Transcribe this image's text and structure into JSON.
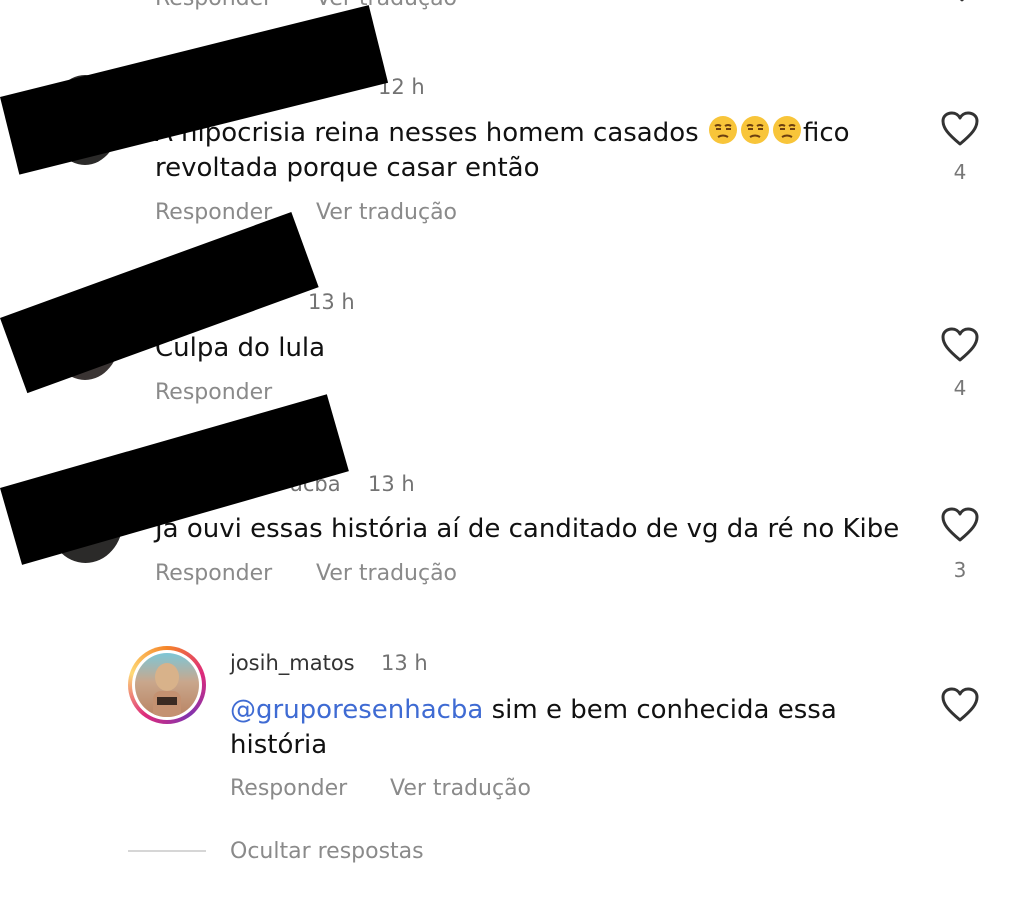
{
  "top_cut": {
    "reply": "Responder",
    "translate": "Ver tradução"
  },
  "comments": [
    {
      "username": "",
      "time": "12 h",
      "text_line1": "A hipocrisia reina nesses homem casados",
      "emoji": "unamused-face",
      "text_after_emoji": "fico",
      "text_line2": "revoltada porque casar então",
      "likes": "4",
      "reply": "Responder",
      "translate": "Ver tradução"
    },
    {
      "username": "",
      "time": "13 h",
      "text": "Culpa do lula",
      "likes": "4",
      "reply": "Responder"
    },
    {
      "username": "acba",
      "time": "13 h",
      "text": "Já ouvi essas história aí de canditado de vg da ré no Kibe",
      "likes": "3",
      "reply": "Responder",
      "translate": "Ver tradução"
    }
  ],
  "reply_comment": {
    "username": "josih_matos",
    "time": "13 h",
    "mention": "@gruporesenhacba",
    "text_rest": " sim e bem conhecida essa",
    "text_line2": "história",
    "reply": "Responder",
    "translate": "Ver tradução"
  },
  "hide_replies": "Ocultar respostas",
  "colors": {
    "mention": "#3f6bd3",
    "meta": "#737373",
    "action": "#8a8a8a",
    "redaction": "#000000"
  },
  "icons": {
    "like": "heart-outline-icon",
    "emoji": "unamused-face-emoji"
  }
}
